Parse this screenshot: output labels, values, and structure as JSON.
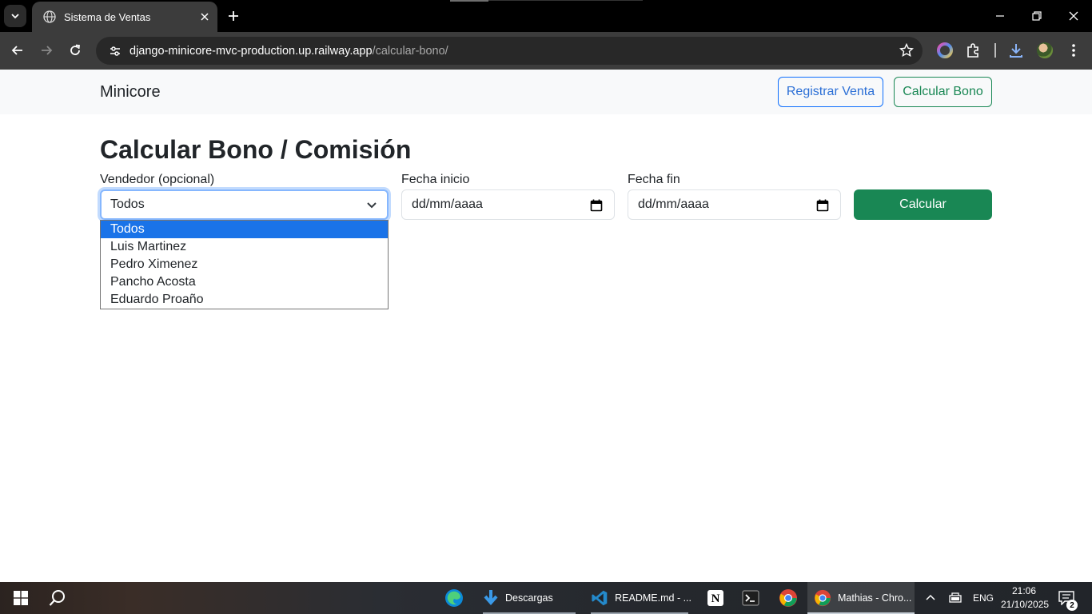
{
  "browser": {
    "tab": {
      "title": "Sistema de Ventas"
    },
    "address": {
      "domain": "django-minicore-mvc-production.up.railway.app",
      "path": "/calcular-bono/"
    }
  },
  "navbar": {
    "brand": "Minicore",
    "registrar_label": "Registrar Venta",
    "calcular_bono_label": "Calcular Bono"
  },
  "main": {
    "title": "Calcular Bono / Comisión",
    "vendedor": {
      "label": "Vendedor (opcional)",
      "selected": "Todos",
      "options": [
        "Todos",
        "Luis Martinez",
        "Pedro Ximenez",
        "Pancho Acosta",
        "Eduardo Proaño"
      ]
    },
    "fecha_inicio": {
      "label": "Fecha inicio",
      "placeholder": "dd/mm/aaaa"
    },
    "fecha_fin": {
      "label": "Fecha fin",
      "placeholder": "dd/mm/aaaa"
    },
    "calcular_label": "Calcular"
  },
  "taskbar": {
    "items": [
      {
        "label": "Descargas"
      },
      {
        "label": "README.md - ..."
      },
      {
        "label": "Mathias - Chro..."
      }
    ],
    "language": "ENG",
    "time": "21:06",
    "date": "21/10/2025",
    "notification_count": "2"
  },
  "colors": {
    "primary": "#0d6efd",
    "success": "#198754",
    "option_highlight": "#1a73e8"
  }
}
